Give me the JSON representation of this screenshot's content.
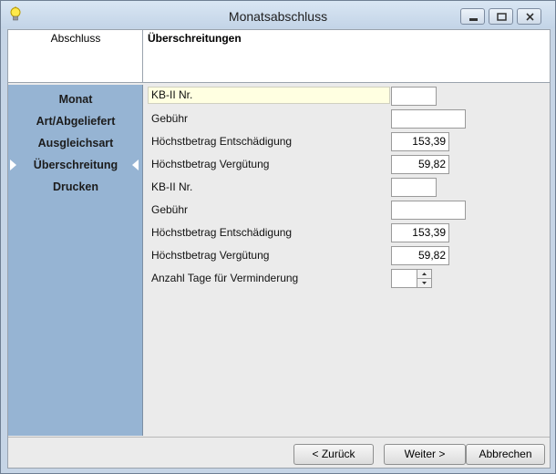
{
  "window": {
    "title": "Monatsabschluss"
  },
  "header": {
    "left_label": "Abschluss",
    "section_title": "Überschreitungen"
  },
  "sidebar": {
    "items": [
      {
        "label": "Monat"
      },
      {
        "label": "Art/Abgeliefert"
      },
      {
        "label": "Ausgleichsart"
      },
      {
        "label": "Überschreitung",
        "selected": true
      },
      {
        "label": "Drucken"
      }
    ]
  },
  "form": {
    "rows": [
      {
        "label": "KB-II Nr.",
        "value": ""
      },
      {
        "label": "Gebühr",
        "value": ""
      },
      {
        "label": "Höchstbetrag Entschädigung",
        "value": "153,39"
      },
      {
        "label": "Höchstbetrag Vergütung",
        "value": "59,82"
      },
      {
        "label": "KB-II Nr.",
        "value": ""
      },
      {
        "label": "Gebühr",
        "value": ""
      },
      {
        "label": "Höchstbetrag Entschädigung",
        "value": "153,39"
      },
      {
        "label": "Höchstbetrag Vergütung",
        "value": "59,82"
      },
      {
        "label": "Anzahl Tage für Verminderung",
        "value": ""
      }
    ]
  },
  "footer": {
    "back": "< Zurück",
    "next": "Weiter >",
    "cancel": "Abbrechen"
  },
  "colors": {
    "sidebar": "#96b4d3",
    "focus_label": "#ffffe1",
    "titlebar": "#c9d9ea"
  }
}
